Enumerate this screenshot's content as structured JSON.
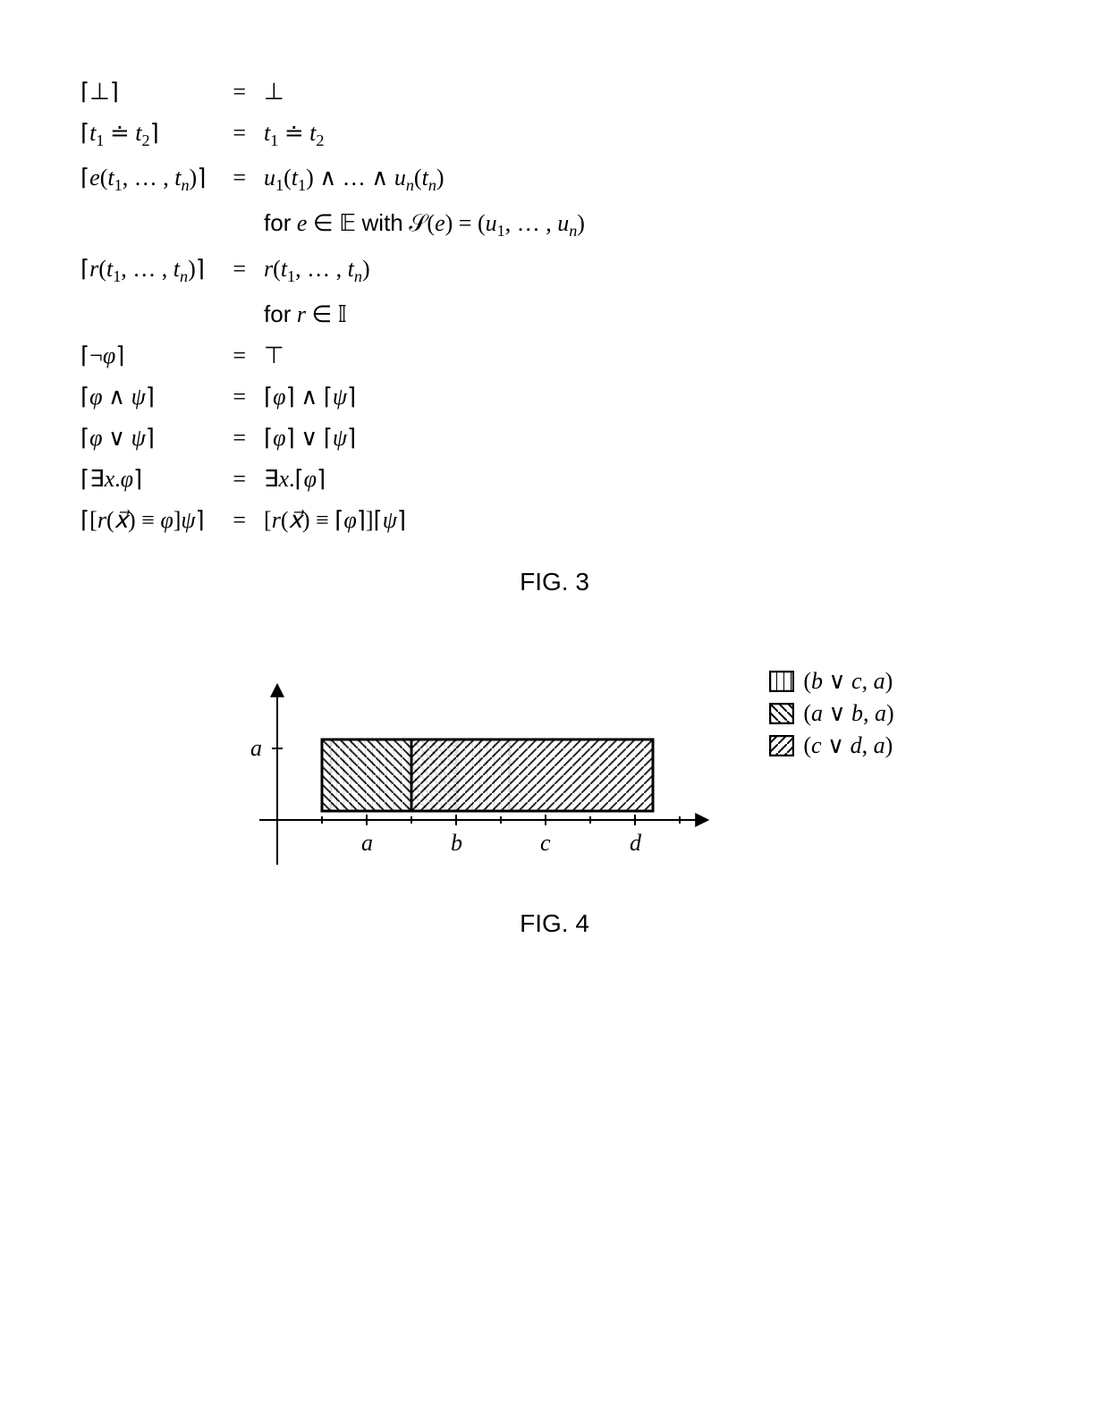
{
  "equations": [
    {
      "lhs": "⌈⊥⌉",
      "rhs": "⊥"
    },
    {
      "lhs": "⌈<span class='m-i'>t</span><sub>1</sub> ≐ <span class='m-i'>t</span><sub>2</sub>⌉",
      "rhs": "<span class='m-i'>t</span><sub>1</sub> ≐ <span class='m-i'>t</span><sub>2</sub>"
    },
    {
      "lhs": "⌈<span class='m-i'>e</span>(<span class='m-i'>t</span><sub>1</sub>, … , <span class='m-i'>t</span><sub><span class='m-i'>n</span></sub>)⌉",
      "rhs": "<span class='m-i'>u</span><sub>1</sub>(<span class='m-i'>t</span><sub>1</sub>) ∧ … ∧ <span class='m-i'>u</span><sub><span class='m-i'>n</span></sub>(<span class='m-i'>t</span><sub><span class='m-i'>n</span></sub>)"
    },
    {
      "lhs": "",
      "rhs": "<span class='sans'>for</span> <span class='m-i'>e</span> ∈ <span class='bb'>𝔼</span> <span class='sans'>with</span> <span class='scr'>𝒮</span>(<span class='m-i'>e</span>) = (<span class='m-i'>u</span><sub>1</sub>, … , <span class='m-i'>u</span><sub><span class='m-i'>n</span></sub>)",
      "noeq": true
    },
    {
      "lhs": "⌈<span class='m-i'>r</span>(<span class='m-i'>t</span><sub>1</sub>, … , <span class='m-i'>t</span><sub><span class='m-i'>n</span></sub>)⌉",
      "rhs": "<span class='m-i'>r</span>(<span class='m-i'>t</span><sub>1</sub>, … , <span class='m-i'>t</span><sub><span class='m-i'>n</span></sub>)"
    },
    {
      "lhs": "",
      "rhs": "<span class='sans'>for</span> <span class='m-i'>r</span> ∈ <span class='bb'>𝕀</span>",
      "noeq": true
    },
    {
      "lhs": "⌈¬<span class='m-i'>φ</span>⌉",
      "rhs": "⊤"
    },
    {
      "lhs": "⌈<span class='m-i'>φ</span> ∧ <span class='m-i'>ψ</span>⌉",
      "rhs": "⌈<span class='m-i'>φ</span>⌉ ∧ ⌈<span class='m-i'>ψ</span>⌉"
    },
    {
      "lhs": "⌈<span class='m-i'>φ</span> ∨ <span class='m-i'>ψ</span>⌉",
      "rhs": "⌈<span class='m-i'>φ</span>⌉ ∨ ⌈<span class='m-i'>ψ</span>⌉"
    },
    {
      "lhs": "⌈∃<span class='m-i'>x</span>.<span class='m-i'>φ</span>⌉",
      "rhs": "∃<span class='m-i'>x</span>.⌈<span class='m-i'>φ</span>⌉"
    },
    {
      "lhs": "⌈[<span class='m-i'>r</span>(<span class='m-i'>x⃗</span>) ≡ <span class='m-i'>φ</span>]<span class='m-i'>ψ</span>⌉",
      "rhs": "[<span class='m-i'>r</span>(<span class='m-i'>x⃗</span>) ≡ ⌈<span class='m-i'>φ</span>⌉]⌈<span class='m-i'>ψ</span>⌉"
    }
  ],
  "eq_symbol": "=",
  "fig3_caption": "FIG. 3",
  "fig4_caption": "FIG. 4",
  "legend": [
    {
      "pattern": "vert",
      "label": "(<span class='m-i'>b</span> ∨ <span class='m-i'>c</span>, <span class='m-i'>a</span>)"
    },
    {
      "pattern": "diag-bwd",
      "label": "(<span class='m-i'>a</span> ∨ <span class='m-i'>b</span>, <span class='m-i'>a</span>)"
    },
    {
      "pattern": "diag-fwd",
      "label": "(<span class='m-i'>c</span> ∨ <span class='m-i'>d</span>, <span class='m-i'>a</span>)"
    }
  ],
  "axis": {
    "xticks": [
      "a",
      "b",
      "c",
      "d"
    ],
    "ylabel": "a"
  },
  "chart_data": {
    "type": "bar",
    "note": "Three overlapping horizontal interval bars on a categorical x-axis {a,b,c,d} at height y=a. Each bar spans an interval derived from its label's disjunction endpoints; height equals 'a'.",
    "x_categories": [
      "a",
      "b",
      "c",
      "d"
    ],
    "y_level": "a",
    "series": [
      {
        "name": "(b ∨ c, a)",
        "pattern": "vertical",
        "x_start_category": "a",
        "x_end_category": "c",
        "x_start_frac": 0.6,
        "x_span_units": 2.0
      },
      {
        "name": "(a ∨ b, a)",
        "pattern": "diag-bwd",
        "x_start_category": "a",
        "x_end_category": "b",
        "x_start_frac": 0.5,
        "x_span_units": 1.5
      },
      {
        "name": "(c ∨ d, a)",
        "pattern": "diag-fwd",
        "x_start_category": "b",
        "x_end_category": "d",
        "x_start_frac": 0.5,
        "x_span_units": 2.7
      }
    ],
    "title": "",
    "xlabel": "",
    "ylabel": ""
  }
}
